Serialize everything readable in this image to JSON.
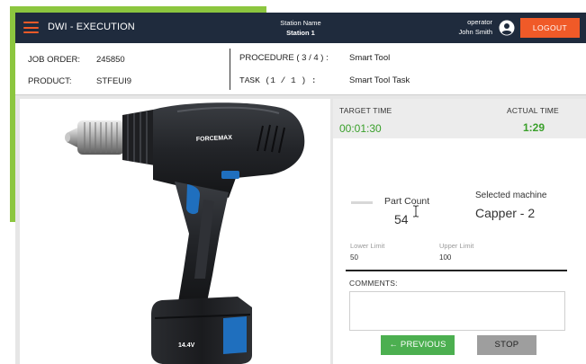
{
  "header": {
    "app_title": "DWI - EXECUTION",
    "station_label": "Station Name",
    "station_value": "Station 1",
    "operator_label": "operator",
    "operator_name": "John Smith",
    "logout_label": "LOGOUT"
  },
  "info": {
    "job_order_label": "JOB ORDER:",
    "job_order_value": "245850",
    "product_label": "PRODUCT:",
    "product_value": "STFEUI9",
    "procedure_label": "PROCEDURE ( 3 / 4 ) :",
    "procedure_value": "Smart Tool",
    "task_label": "TASK  (1  /  1 ) :",
    "task_value": "Smart Tool Task"
  },
  "image": {
    "brand_text": "FORCEMAX",
    "battery_text": "14.4V"
  },
  "panel": {
    "target_time_label": "TARGET TIME",
    "target_time_value": "00:01:30",
    "actual_time_label": "ACTUAL TIME",
    "actual_time_value": "1:29",
    "part_count_label": "Part Count",
    "part_count_value": "54",
    "machine_label": "Selected machine",
    "machine_value": "Capper - 2",
    "lower_limit_label": "Lower Limit",
    "lower_limit_value": "50",
    "upper_limit_label": "Upper Limit",
    "upper_limit_value": "100",
    "comments_label": "COMMENTS:",
    "comments_value": "",
    "previous_label": "PREVIOUS",
    "stop_label": "STOP"
  },
  "colors": {
    "topbar": "#1f2b3d",
    "accent_orange": "#f05a28",
    "accent_green": "#8cc63f",
    "time_green": "#3aa02b",
    "previous_button": "#4caf50",
    "stop_button": "#9e9e9e"
  },
  "icons": {
    "menu": "hamburger-menu-icon",
    "user": "user-circle-icon",
    "previous": "arrow-left-icon",
    "cursor": "text-cursor-icon"
  }
}
